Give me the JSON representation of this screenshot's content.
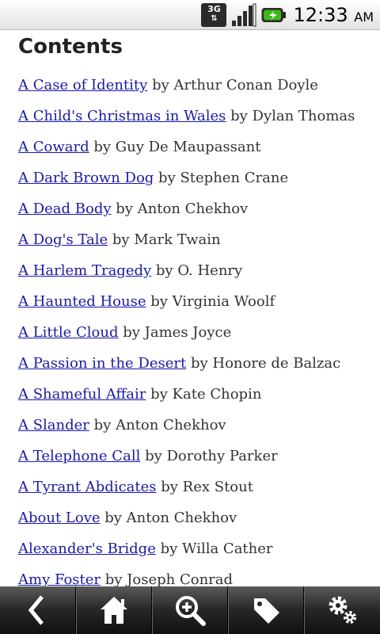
{
  "status_bar": {
    "network_label": "3G",
    "time": "12:33",
    "ampm": "AM",
    "icons": [
      "network-3g-icon",
      "signal-icon",
      "battery-icon"
    ]
  },
  "page": {
    "title": "Contents"
  },
  "stories": [
    {
      "title": "A Case of Identity",
      "author": "by Arthur Conan Doyle"
    },
    {
      "title": "A Child's Christmas in Wales",
      "author": "by Dylan Thomas"
    },
    {
      "title": "A Coward",
      "author": "by Guy De Maupassant"
    },
    {
      "title": "A Dark Brown Dog",
      "author": "by Stephen Crane"
    },
    {
      "title": "A Dead Body",
      "author": "by Anton Chekhov"
    },
    {
      "title": "A Dog's Tale",
      "author": "by Mark Twain"
    },
    {
      "title": "A Harlem Tragedy",
      "author": "by O. Henry"
    },
    {
      "title": "A Haunted House",
      "author": "by Virginia Woolf"
    },
    {
      "title": "A Little Cloud",
      "author": "by James Joyce"
    },
    {
      "title": "A Passion in the Desert",
      "author": "by Honore de Balzac"
    },
    {
      "title": "A Shameful Affair",
      "author": "by Kate Chopin"
    },
    {
      "title": "A Slander",
      "author": "by Anton Chekhov"
    },
    {
      "title": "A Telephone Call",
      "author": "by Dorothy Parker"
    },
    {
      "title": "A Tyrant Abdicates",
      "author": "by Rex Stout"
    },
    {
      "title": "About Love",
      "author": "by Anton Chekhov"
    },
    {
      "title": "Alexander's Bridge",
      "author": "by Willa Cather"
    },
    {
      "title": "Amy Foster",
      "author": "by Joseph Conrad"
    }
  ],
  "toolbar": {
    "buttons": [
      "back-icon",
      "home-icon",
      "zoom-in-icon",
      "tag-icon",
      "settings-icon"
    ]
  },
  "colors": {
    "link": "#1a1aa6",
    "text": "#333333",
    "toolbar": "#262626",
    "battery": "#3fb618"
  }
}
